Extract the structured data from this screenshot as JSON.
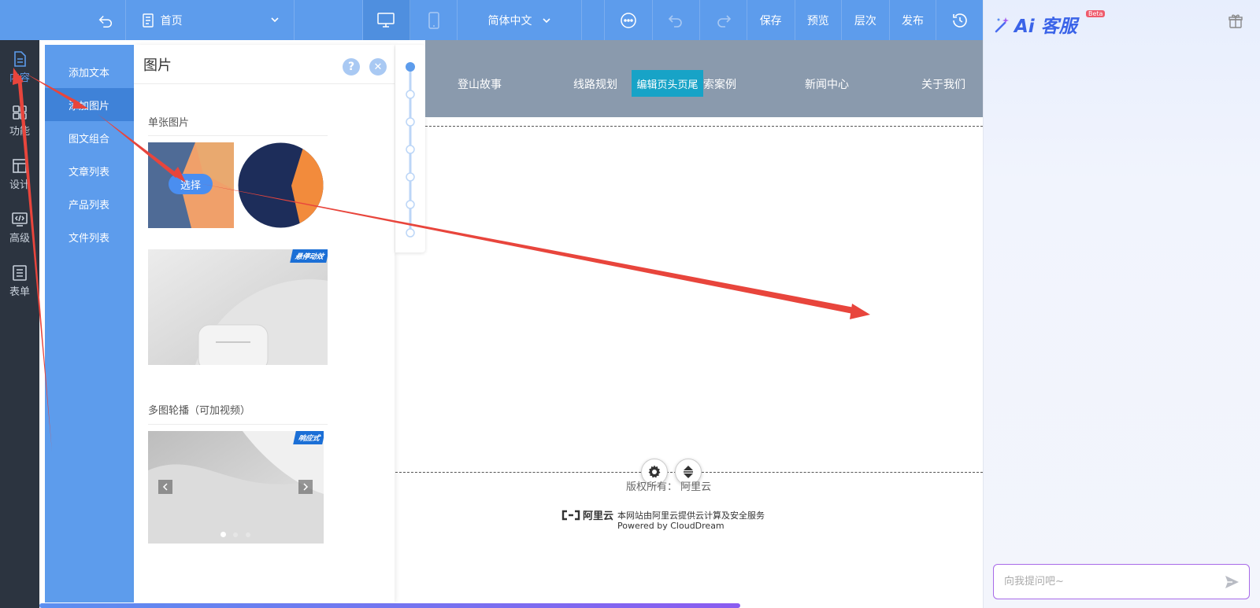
{
  "toolbar": {
    "page_select": "首页",
    "language_select": "简体中文",
    "save": "保存",
    "preview": "预览",
    "layers": "层次",
    "publish": "发布"
  },
  "leftnav": [
    {
      "label": "内容",
      "icon": "document-icon"
    },
    {
      "label": "功能",
      "icon": "grid-icon"
    },
    {
      "label": "设计",
      "icon": "layout-icon"
    },
    {
      "label": "高级",
      "icon": "code-icon"
    },
    {
      "label": "表单",
      "icon": "form-icon"
    }
  ],
  "submenu": [
    {
      "label": "添加文本"
    },
    {
      "label": "添加图片"
    },
    {
      "label": "图文组合"
    },
    {
      "label": "文章列表"
    },
    {
      "label": "产品列表"
    },
    {
      "label": "文件列表"
    }
  ],
  "panel": {
    "title": "图片",
    "help": "?",
    "close": "✕",
    "section_single": "单张图片",
    "select_btn": "选择",
    "badge_hover": "悬停动效",
    "section_carousel": "多图轮播（可加视频）",
    "badge_responsive": "响应式"
  },
  "canvas": {
    "nav": [
      "登山故事",
      "线路规划",
      "索案例",
      "新闻中心",
      "关于我们"
    ],
    "edit_tag": "编辑页头页尾",
    "copyright": "版权所有：  阿里云",
    "footer_logo": "阿里云",
    "footer_service": "本网站由阿里云提供云计算及安全服务",
    "footer_powered": "Powered by CloudDream"
  },
  "ai": {
    "brand": "Ai 客服",
    "beta": "Beta",
    "input_placeholder": "向我提问吧~"
  },
  "colors": {
    "toolbar": "#5d9cec",
    "leftnav": "#2c3440",
    "submenu_active": "#3f82d8",
    "annotation": "#e8453c"
  }
}
